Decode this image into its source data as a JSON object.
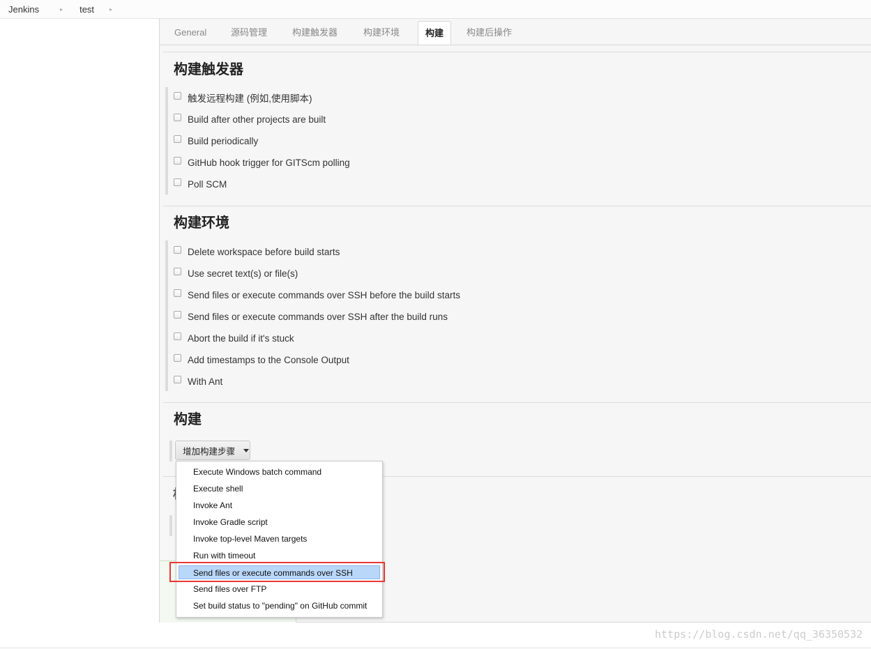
{
  "breadcrumb": {
    "root": "Jenkins",
    "project": "test",
    "separator": "▸"
  },
  "tabs": [
    {
      "label": "General"
    },
    {
      "label": "源码管理"
    },
    {
      "label": "构建触发器"
    },
    {
      "label": "构建环境"
    },
    {
      "label": "构建",
      "active": true
    },
    {
      "label": "构建后操作"
    }
  ],
  "triggers": {
    "title": "构建触发器",
    "options": [
      "触发远程构建 (例如,使用脚本)",
      "Build after other projects are built",
      "Build periodically",
      "GitHub hook trigger for GITScm polling",
      "Poll SCM"
    ]
  },
  "environment": {
    "title": "构建环境",
    "options": [
      "Delete workspace before build starts",
      "Use secret text(s) or file(s)",
      "Send files or execute commands over SSH before the build starts",
      "Send files or execute commands over SSH after the build runs",
      "Abort the build if it's stuck",
      "Add timestamps to the Console Output",
      "With Ant"
    ]
  },
  "build": {
    "title": "构建",
    "add_step_label": "增加构建步骤",
    "menu_items": [
      "Execute Windows batch command",
      "Execute shell",
      "Invoke Ant",
      "Invoke Gradle script",
      "Invoke top-level Maven targets",
      "Run with timeout",
      "Send files or execute commands over SSH",
      "Send files over FTP",
      "Set build status to \"pending\" on GitHub commit"
    ],
    "selected_item": "Send files or execute commands over SSH"
  },
  "behind_menu_glyph": "构",
  "watermark": "https://blog.csdn.net/qq_36350532",
  "colors": {
    "highlight_border": "#e53935",
    "menu_selected_bg": "#b9d7f9",
    "panel_bg": "#f6f6f6"
  }
}
